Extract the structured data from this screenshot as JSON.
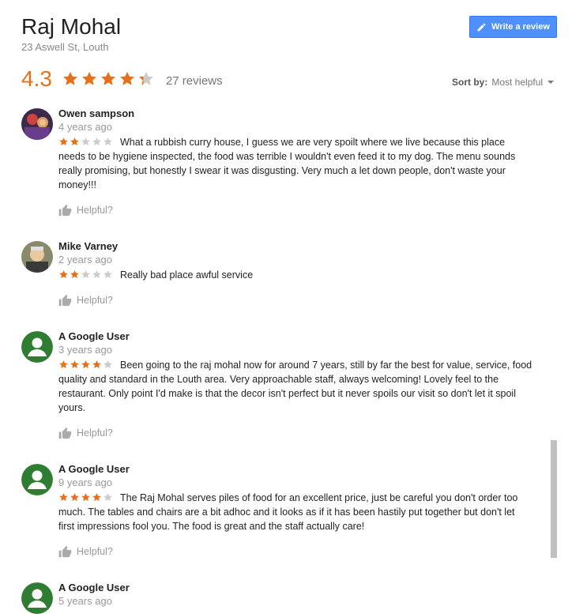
{
  "place": {
    "name": "Raj Mohal",
    "address": "23 Aswell St, Louth",
    "rating": "4.3",
    "rating_value": 4.3,
    "review_count": "27 reviews"
  },
  "toolbar": {
    "write_review_label": "Write a review"
  },
  "sort": {
    "label": "Sort by:",
    "value": "Most helpful"
  },
  "colors": {
    "accent": "#e7711b",
    "button": "#4d90fe",
    "star_empty": "#cccccc",
    "avatar_green": "#2e7d32"
  },
  "reviews": [
    {
      "author": "Owen sampson",
      "date": "4 years ago",
      "stars": 2,
      "text": "What a rubbish curry house, I guess we are very spoilt where we live because this place needs to be hygiene inspected, the food was terrible I wouldn't even feed it to my dog. The menu sounds really promising, but honestly I swear it was disgusting. Very much a let down people, don't waste your money!!!",
      "helpful": "Helpful?",
      "avatar": "photo-avatar"
    },
    {
      "author": "Mike Varney",
      "date": "2 years ago",
      "stars": 2,
      "text": "Really bad place awful service",
      "helpful": "Helpful?",
      "avatar": "photo-avatar"
    },
    {
      "author": "A Google User",
      "date": "3 years ago",
      "stars": 4,
      "text": "Been going to the raj mohal now for around 7 years, still by far the best for value, service, food quality and standard in the Louth area. Very approachable staff, always welcoming! Lovely feel to the restaurant. Only point I'd make is that the decor isn't perfect but it never spoils our visit so don't let it spoil yours.",
      "helpful": "Helpful?",
      "avatar": "default-user-avatar"
    },
    {
      "author": "A Google User",
      "date": "9 years ago",
      "stars": 4,
      "text": "The Raj Mohal serves piles of food for an excellent price, just be careful you don't order too much.  The tables and chairs are a bit adhoc and it looks as if it has been hastily put together but don't let first impressions fool you.   The food is great and the staff actually care!",
      "helpful": "Helpful?",
      "avatar": "default-user-avatar"
    },
    {
      "author": "A Google User",
      "date": "5 years ago",
      "avatar": "default-user-avatar"
    }
  ]
}
